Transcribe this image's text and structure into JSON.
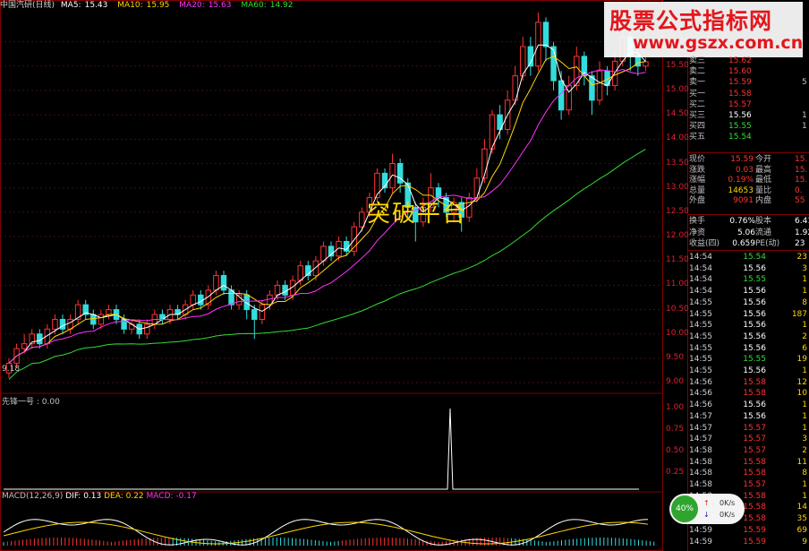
{
  "header": {
    "stock_name": "中国汽研(日线)",
    "ma": [
      {
        "label": "MA5:",
        "value": "15.43",
        "color": "#ffffff"
      },
      {
        "label": "MA10:",
        "value": "15.95",
        "color": "#ffd700"
      },
      {
        "label": "MA20:",
        "value": "15.63",
        "color": "#ff33ff"
      },
      {
        "label": "MA60:",
        "value": "14.92",
        "color": "#33dd33"
      }
    ]
  },
  "price_axis": [
    "16.00",
    "15.50",
    "15.00",
    "14.50",
    "14.00",
    "13.50",
    "13.00",
    "12.50",
    "12.00",
    "11.50",
    "11.00",
    "10.50",
    "10.00",
    "9.50",
    "9.00"
  ],
  "low_marker": "9.18",
  "annotation": "突破平台",
  "watermark": {
    "title": "股票公式指标网",
    "url": "www.gszx.com.cn"
  },
  "indicator_panel": {
    "label": "先锋一号 : 0.00",
    "axis": [
      "1.00",
      "0.75",
      "0.50",
      "0.25"
    ]
  },
  "macd_panel": {
    "name": "MACD(12,26,9)",
    "dif": "DIF: 0.13",
    "dea": "DEA: 0.22",
    "macd": "MACD: -0.17"
  },
  "order_book": [
    {
      "label": "卖三",
      "price": "15.62",
      "vol": "",
      "color": "#ff3333"
    },
    {
      "label": "卖二",
      "price": "15.60",
      "vol": "",
      "color": "#ff3333"
    },
    {
      "label": "卖一",
      "price": "15.59",
      "vol": "5",
      "color": "#ff3333"
    },
    {
      "label": "买一",
      "price": "15.58",
      "vol": "",
      "color": "#ff3333"
    },
    {
      "label": "买二",
      "price": "15.57",
      "vol": "",
      "color": "#ff3333"
    },
    {
      "label": "买三",
      "price": "15.56",
      "vol": "1",
      "color": "#ffffff"
    },
    {
      "label": "买四",
      "price": "15.55",
      "vol": "1",
      "color": "#33dd33"
    },
    {
      "label": "买五",
      "price": "15.54",
      "vol": "",
      "color": "#33dd33"
    }
  ],
  "quote_stats": [
    {
      "l1": "现价",
      "v1": "15.59",
      "c1": "#ff3333",
      "l2": "今开",
      "v2": "15."
    },
    {
      "l1": "涨跌",
      "v1": "0.03",
      "c1": "#ff3333",
      "l2": "最高",
      "v2": "15."
    },
    {
      "l1": "涨幅",
      "v1": "0.19%",
      "c1": "#ff3333",
      "l2": "最低",
      "v2": "15."
    },
    {
      "l1": "总量",
      "v1": "14653",
      "c1": "#ffd700",
      "l2": "量比",
      "v2": "0."
    },
    {
      "l1": "外盘",
      "v1": "9091",
      "c1": "#ff3333",
      "l2": "内盘",
      "v2": "55"
    }
  ],
  "fund_stats": [
    {
      "l1": "换手",
      "v1": "0.76%",
      "l2": "股本",
      "v2": "6.41"
    },
    {
      "l1": "净资",
      "v1": "5.06",
      "l2": "流通",
      "v2": "1.92"
    },
    {
      "l1": "收益(四)",
      "v1": "0.659",
      "l2": "PE(动)",
      "v2": "23"
    }
  ],
  "ticks": [
    {
      "time": "14:54",
      "price": "15.54",
      "vol": "23",
      "color": "#33dd33"
    },
    {
      "time": "14:54",
      "price": "15.56",
      "vol": "3",
      "color": "#ffffff"
    },
    {
      "time": "14:54",
      "price": "15.55",
      "vol": "1",
      "color": "#33dd33"
    },
    {
      "time": "14:54",
      "price": "15.56",
      "vol": "1",
      "color": "#ffffff"
    },
    {
      "time": "14:55",
      "price": "15.56",
      "vol": "8",
      "color": "#ffffff"
    },
    {
      "time": "14:55",
      "price": "15.56",
      "vol": "187",
      "color": "#ffffff"
    },
    {
      "time": "14:55",
      "price": "15.56",
      "vol": "1",
      "color": "#ffffff"
    },
    {
      "time": "14:55",
      "price": "15.56",
      "vol": "2",
      "color": "#ffffff"
    },
    {
      "time": "14:55",
      "price": "15.56",
      "vol": "6",
      "color": "#ffffff"
    },
    {
      "time": "14:55",
      "price": "15.55",
      "vol": "19",
      "color": "#33dd33"
    },
    {
      "time": "14:55",
      "price": "15.56",
      "vol": "1",
      "color": "#ffffff"
    },
    {
      "time": "14:56",
      "price": "15.58",
      "vol": "12",
      "color": "#ff3333"
    },
    {
      "time": "14:56",
      "price": "15.58",
      "vol": "10",
      "color": "#ff3333"
    },
    {
      "time": "14:56",
      "price": "15.56",
      "vol": "1",
      "color": "#ffffff"
    },
    {
      "time": "14:57",
      "price": "15.56",
      "vol": "1",
      "color": "#ffffff"
    },
    {
      "time": "14:57",
      "price": "15.57",
      "vol": "1",
      "color": "#ff3333"
    },
    {
      "time": "14:57",
      "price": "15.57",
      "vol": "3",
      "color": "#ff3333"
    },
    {
      "time": "14:58",
      "price": "15.57",
      "vol": "2",
      "color": "#ff3333"
    },
    {
      "time": "14:58",
      "price": "15.58",
      "vol": "11",
      "color": "#ff3333"
    },
    {
      "time": "14:58",
      "price": "15.58",
      "vol": "8",
      "color": "#ff3333"
    },
    {
      "time": "14:58",
      "price": "15.57",
      "vol": "1",
      "color": "#ff3333"
    },
    {
      "time": "14:58",
      "price": "15.58",
      "vol": "1",
      "color": "#ff3333"
    },
    {
      "time": "14:58",
      "price": "15.58",
      "vol": "14",
      "color": "#ff3333"
    },
    {
      "time": "14:59",
      "price": "15.58",
      "vol": "35",
      "color": "#ff3333"
    },
    {
      "time": "14:59",
      "price": "15.59",
      "vol": "69",
      "color": "#ff3333"
    },
    {
      "time": "14:59",
      "price": "15.59",
      "vol": "9",
      "color": "#ff3333"
    }
  ],
  "speed_widget": {
    "percent": "40%",
    "up": "0K/s",
    "down": "0K/s"
  },
  "chart_data": {
    "type": "candlestick",
    "ma_colors": {
      "ma5": "#ffffff",
      "ma10": "#ffd700",
      "ma20": "#ff33ff",
      "ma60": "#33dd33"
    },
    "up_color": "#ff3333",
    "down_color": "#33dddd",
    "ylim": [
      8.8,
      16.6
    ],
    "candles": [
      [
        9.2,
        9.4,
        9.1,
        9.5
      ],
      [
        9.4,
        9.7,
        9.3,
        9.8
      ],
      [
        9.7,
        9.8,
        9.6,
        10.0
      ],
      [
        9.8,
        10.0,
        9.7,
        10.1
      ],
      [
        10.0,
        9.8,
        9.7,
        10.1
      ],
      [
        9.8,
        10.1,
        9.7,
        10.2
      ],
      [
        10.1,
        10.3,
        10.0,
        10.4
      ],
      [
        10.3,
        10.1,
        10.0,
        10.4
      ],
      [
        10.1,
        10.3,
        10.0,
        10.4
      ],
      [
        10.3,
        10.6,
        10.2,
        10.7
      ],
      [
        10.6,
        10.4,
        10.3,
        10.7
      ],
      [
        10.4,
        10.2,
        10.1,
        10.5
      ],
      [
        10.2,
        10.4,
        10.1,
        10.5
      ],
      [
        10.4,
        10.5,
        10.3,
        10.6
      ],
      [
        10.5,
        10.3,
        10.2,
        10.6
      ],
      [
        10.3,
        10.1,
        10.0,
        10.4
      ],
      [
        10.1,
        10.2,
        10.0,
        10.3
      ],
      [
        10.2,
        10.0,
        9.9,
        10.3
      ],
      [
        10.0,
        10.2,
        9.9,
        10.3
      ],
      [
        10.2,
        10.4,
        10.1,
        10.5
      ],
      [
        10.4,
        10.3,
        10.2,
        10.5
      ],
      [
        10.3,
        10.5,
        10.2,
        10.6
      ],
      [
        10.5,
        10.4,
        10.3,
        10.6
      ],
      [
        10.4,
        10.6,
        10.3,
        10.7
      ],
      [
        10.6,
        10.8,
        10.5,
        10.9
      ],
      [
        10.8,
        10.6,
        10.5,
        10.9
      ],
      [
        10.6,
        10.9,
        10.5,
        11.0
      ],
      [
        10.9,
        11.2,
        10.8,
        11.3
      ],
      [
        11.2,
        10.9,
        10.8,
        11.3
      ],
      [
        10.9,
        10.6,
        10.5,
        11.0
      ],
      [
        10.6,
        10.8,
        10.5,
        10.9
      ],
      [
        10.8,
        10.5,
        10.3,
        10.9
      ],
      [
        10.5,
        10.3,
        9.9,
        10.6
      ],
      [
        10.3,
        10.6,
        10.2,
        10.7
      ],
      [
        10.6,
        10.8,
        10.5,
        10.9
      ],
      [
        10.8,
        11.0,
        10.7,
        11.1
      ],
      [
        11.0,
        10.8,
        10.7,
        11.1
      ],
      [
        10.8,
        11.1,
        10.7,
        11.2
      ],
      [
        11.1,
        11.4,
        11.0,
        11.5
      ],
      [
        11.4,
        11.2,
        11.1,
        11.5
      ],
      [
        11.2,
        11.5,
        11.1,
        11.6
      ],
      [
        11.5,
        11.8,
        11.4,
        11.9
      ],
      [
        11.8,
        11.6,
        11.5,
        11.9
      ],
      [
        11.6,
        11.9,
        11.5,
        12.0
      ],
      [
        11.9,
        11.7,
        11.6,
        12.0
      ],
      [
        11.7,
        12.2,
        11.6,
        12.3
      ],
      [
        12.2,
        12.5,
        12.1,
        12.6
      ],
      [
        12.5,
        12.8,
        12.4,
        12.9
      ],
      [
        12.8,
        13.3,
        12.7,
        13.4
      ],
      [
        13.3,
        13.0,
        12.9,
        13.4
      ],
      [
        13.0,
        13.5,
        12.9,
        13.7
      ],
      [
        13.5,
        13.1,
        12.9,
        13.6
      ],
      [
        13.1,
        12.6,
        12.4,
        13.2
      ],
      [
        12.6,
        12.3,
        11.9,
        12.7
      ],
      [
        12.3,
        12.6,
        12.2,
        12.8
      ],
      [
        12.6,
        13.0,
        12.5,
        13.3
      ],
      [
        13.0,
        12.8,
        12.6,
        13.1
      ],
      [
        12.8,
        12.5,
        12.4,
        12.9
      ],
      [
        12.5,
        12.7,
        12.3,
        12.8
      ],
      [
        12.7,
        12.4,
        12.1,
        12.8
      ],
      [
        12.4,
        12.8,
        12.3,
        12.9
      ],
      [
        12.8,
        13.2,
        12.7,
        13.4
      ],
      [
        13.2,
        13.8,
        13.1,
        14.0
      ],
      [
        13.8,
        14.5,
        13.7,
        14.6
      ],
      [
        14.5,
        14.2,
        14.0,
        14.7
      ],
      [
        14.2,
        14.8,
        14.1,
        15.0
      ],
      [
        14.8,
        15.3,
        14.7,
        15.5
      ],
      [
        15.3,
        15.9,
        15.2,
        16.1
      ],
      [
        15.9,
        15.5,
        15.3,
        16.1
      ],
      [
        15.5,
        16.4,
        15.4,
        16.6
      ],
      [
        16.4,
        15.9,
        15.6,
        16.5
      ],
      [
        15.9,
        15.2,
        15.0,
        16.0
      ],
      [
        15.2,
        14.6,
        14.4,
        15.4
      ],
      [
        14.6,
        15.1,
        14.5,
        15.3
      ],
      [
        15.1,
        15.7,
        15.0,
        15.9
      ],
      [
        15.7,
        15.3,
        15.1,
        15.8
      ],
      [
        15.3,
        14.8,
        14.5,
        15.4
      ],
      [
        14.8,
        15.4,
        14.7,
        15.6
      ],
      [
        15.4,
        15.1,
        14.9,
        15.5
      ],
      [
        15.1,
        15.6,
        15.0,
        15.8
      ],
      [
        15.6,
        16.1,
        15.5,
        16.3
      ],
      [
        16.1,
        15.7,
        15.4,
        16.2
      ],
      [
        15.7,
        15.5,
        15.3,
        15.9
      ],
      [
        15.5,
        15.59,
        15.4,
        15.7
      ]
    ]
  }
}
